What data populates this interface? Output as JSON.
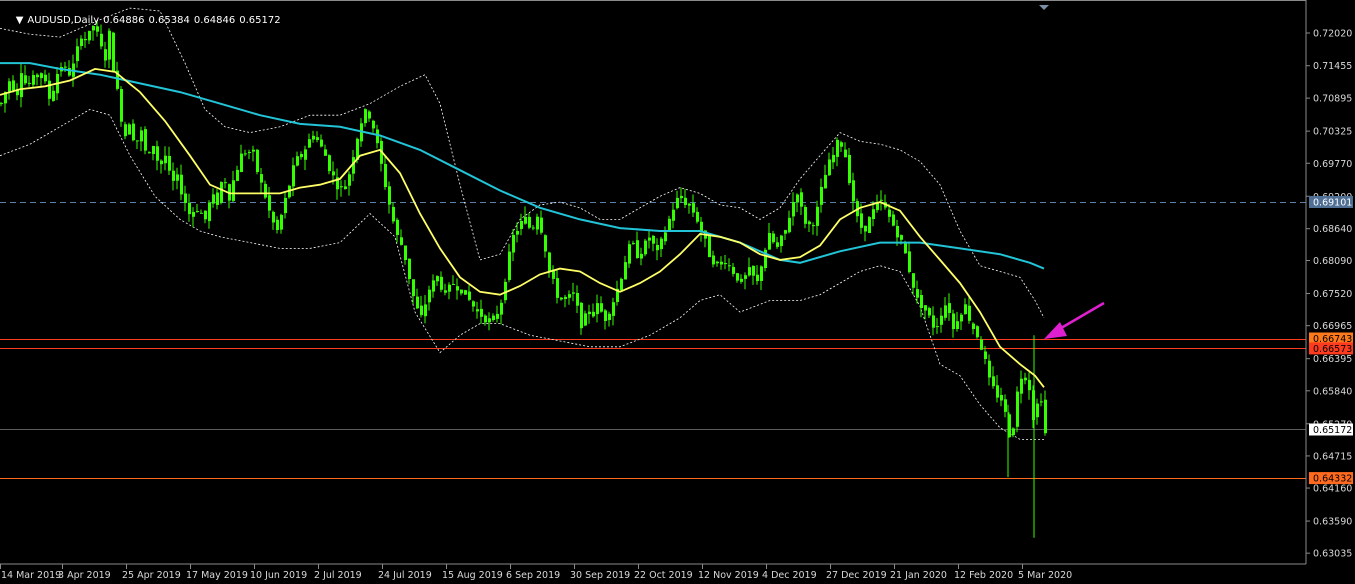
{
  "header": {
    "symbol": "AUDUSD,Daily",
    "open": "0.64886",
    "high": "0.65384",
    "low": "0.64846",
    "close": "0.65172"
  },
  "colors": {
    "background": "#000000",
    "candles": "#33ff00",
    "ma_fast": "#ffff66",
    "ma_slow": "#22c4d8",
    "bands": "#ffffff",
    "resistance": "#ff3b1f",
    "support": "#ff6a1f",
    "dashed_level": "#5a7fa8",
    "arrow": "#e020d0",
    "axis": "#d8d8d8"
  },
  "chart_data": {
    "type": "line",
    "symbol": "AUDUSD",
    "timeframe": "Daily",
    "ylim": [
      0.63,
      0.726
    ],
    "yticks": [
      "0.72020",
      "0.71455",
      "0.70895",
      "0.70325",
      "0.69770",
      "0.69200",
      "0.68640",
      "0.68090",
      "0.67520",
      "0.66965",
      "0.66395",
      "0.65840",
      "0.65270",
      "0.64715",
      "0.64160",
      "0.63590",
      "0.63035"
    ],
    "x_labels": [
      "14 Mar 2019",
      "3 Apr 2019",
      "25 Apr 2019",
      "17 May 2019",
      "10 Jun 2019",
      "2 Jul 2019",
      "24 Jul 2019",
      "15 Aug 2019",
      "6 Sep 2019",
      "30 Sep 2019",
      "22 Oct 2019",
      "12 Nov 2019",
      "4 Dec 2019",
      "27 Dec 2019",
      "21 Jan 2020",
      "12 Feb 2020",
      "5 Mar 2020"
    ],
    "price_levels": [
      {
        "value": 0.69101,
        "label": "0.69101",
        "style": "dashed"
      },
      {
        "value": 0.66743,
        "label": "0.66743",
        "style": "solid"
      },
      {
        "value": 0.66573,
        "label": "0.66573",
        "style": "solid"
      },
      {
        "value": 0.65172,
        "label": "0.65172",
        "style": "current"
      },
      {
        "value": 0.64332,
        "label": "0.64332",
        "style": "solid"
      }
    ],
    "price_path": [
      [
        0,
        0.708
      ],
      [
        8,
        0.712
      ],
      [
        16,
        0.71
      ],
      [
        20,
        0.714
      ],
      [
        25,
        0.711
      ],
      [
        34,
        0.7125
      ],
      [
        40,
        0.7135
      ],
      [
        48,
        0.709
      ],
      [
        54,
        0.7115
      ],
      [
        58,
        0.715
      ],
      [
        63,
        0.714
      ],
      [
        70,
        0.713
      ],
      [
        74,
        0.716
      ],
      [
        80,
        0.72
      ],
      [
        86,
        0.719
      ],
      [
        92,
        0.7215
      ],
      [
        98,
        0.719
      ],
      [
        103,
        0.715
      ],
      [
        108,
        0.72
      ],
      [
        113,
        0.713
      ],
      [
        118,
        0.708
      ],
      [
        123,
        0.702
      ],
      [
        128,
        0.705
      ],
      [
        134,
        0.701
      ],
      [
        140,
        0.703
      ],
      [
        146,
        0.698
      ],
      [
        152,
        0.701
      ],
      [
        158,
        0.697
      ],
      [
        164,
        0.699
      ],
      [
        170,
        0.694
      ],
      [
        176,
        0.695
      ],
      [
        182,
        0.692
      ],
      [
        188,
        0.689
      ],
      [
        196,
        0.69
      ],
      [
        204,
        0.688
      ],
      [
        210,
        0.692
      ],
      [
        216,
        0.691
      ],
      [
        222,
        0.696
      ],
      [
        228,
        0.692
      ],
      [
        234,
        0.696
      ],
      [
        240,
        0.699
      ],
      [
        246,
        0.7
      ],
      [
        252,
        0.699
      ],
      [
        258,
        0.695
      ],
      [
        264,
        0.692
      ],
      [
        270,
        0.688
      ],
      [
        276,
        0.686
      ],
      [
        282,
        0.69
      ],
      [
        288,
        0.694
      ],
      [
        294,
        0.698
      ],
      [
        300,
        0.699
      ],
      [
        306,
        0.701
      ],
      [
        312,
        0.703
      ],
      [
        318,
        0.701
      ],
      [
        324,
        0.699
      ],
      [
        330,
        0.696
      ],
      [
        336,
        0.694
      ],
      [
        342,
        0.693
      ],
      [
        348,
        0.696
      ],
      [
        354,
        0.701
      ],
      [
        360,
        0.705
      ],
      [
        366,
        0.707
      ],
      [
        372,
        0.704
      ],
      [
        378,
        0.699
      ],
      [
        384,
        0.694
      ],
      [
        390,
        0.689
      ],
      [
        396,
        0.685
      ],
      [
        402,
        0.683
      ],
      [
        408,
        0.678
      ],
      [
        414,
        0.673
      ],
      [
        420,
        0.671
      ],
      [
        428,
        0.676
      ],
      [
        436,
        0.678
      ],
      [
        444,
        0.675
      ],
      [
        452,
        0.677
      ],
      [
        460,
        0.676
      ],
      [
        468,
        0.674
      ],
      [
        476,
        0.672
      ],
      [
        484,
        0.671
      ],
      [
        492,
        0.67
      ],
      [
        500,
        0.674
      ],
      [
        506,
        0.68
      ],
      [
        512,
        0.685
      ],
      [
        518,
        0.687
      ],
      [
        524,
        0.688
      ],
      [
        530,
        0.686
      ],
      [
        536,
        0.689
      ],
      [
        542,
        0.685
      ],
      [
        548,
        0.679
      ],
      [
        556,
        0.675
      ],
      [
        564,
        0.674
      ],
      [
        572,
        0.675
      ],
      [
        580,
        0.67
      ],
      [
        588,
        0.672
      ],
      [
        596,
        0.673
      ],
      [
        604,
        0.671
      ],
      [
        612,
        0.674
      ],
      [
        618,
        0.677
      ],
      [
        624,
        0.681
      ],
      [
        630,
        0.684
      ],
      [
        636,
        0.682
      ],
      [
        642,
        0.683
      ],
      [
        648,
        0.685
      ],
      [
        656,
        0.682
      ],
      [
        664,
        0.686
      ],
      [
        672,
        0.69
      ],
      [
        678,
        0.692
      ],
      [
        684,
        0.691
      ],
      [
        690,
        0.69
      ],
      [
        696,
        0.688
      ],
      [
        702,
        0.685
      ],
      [
        708,
        0.682
      ],
      [
        716,
        0.68
      ],
      [
        724,
        0.681
      ],
      [
        732,
        0.679
      ],
      [
        740,
        0.677
      ],
      [
        748,
        0.679
      ],
      [
        756,
        0.677
      ],
      [
        762,
        0.682
      ],
      [
        768,
        0.685
      ],
      [
        776,
        0.683
      ],
      [
        784,
        0.686
      ],
      [
        790,
        0.69
      ],
      [
        796,
        0.693
      ],
      [
        802,
        0.688
      ],
      [
        808,
        0.687
      ],
      [
        814,
        0.688
      ],
      [
        820,
        0.693
      ],
      [
        826,
        0.697
      ],
      [
        832,
        0.699
      ],
      [
        838,
        0.702
      ],
      [
        844,
        0.699
      ],
      [
        850,
        0.693
      ],
      [
        856,
        0.688
      ],
      [
        862,
        0.686
      ],
      [
        868,
        0.688
      ],
      [
        874,
        0.69
      ],
      [
        880,
        0.691
      ],
      [
        886,
        0.689
      ],
      [
        892,
        0.687
      ],
      [
        898,
        0.685
      ],
      [
        904,
        0.682
      ],
      [
        910,
        0.678
      ],
      [
        916,
        0.674
      ],
      [
        922,
        0.673
      ],
      [
        928,
        0.671
      ],
      [
        934,
        0.669
      ],
      [
        940,
        0.672
      ],
      [
        946,
        0.674
      ],
      [
        952,
        0.669
      ],
      [
        958,
        0.672
      ],
      [
        964,
        0.673
      ],
      [
        970,
        0.67
      ],
      [
        976,
        0.668
      ],
      [
        982,
        0.665
      ],
      [
        988,
        0.66
      ],
      [
        994,
        0.658
      ],
      [
        1000,
        0.657
      ],
      [
        1006,
        0.653
      ],
      [
        1010,
        0.649
      ],
      [
        1014,
        0.656
      ],
      [
        1018,
        0.66
      ],
      [
        1022,
        0.662
      ],
      [
        1026,
        0.66
      ],
      [
        1030,
        0.658
      ],
      [
        1034,
        0.65
      ],
      [
        1038,
        0.662
      ],
      [
        1041,
        0.655
      ],
      [
        1044,
        0.651
      ]
    ],
    "ma_fast": [
      [
        0,
        0.7095
      ],
      [
        20,
        0.7105
      ],
      [
        45,
        0.711
      ],
      [
        70,
        0.712
      ],
      [
        95,
        0.714
      ],
      [
        115,
        0.7135
      ],
      [
        140,
        0.71
      ],
      [
        165,
        0.705
      ],
      [
        190,
        0.699
      ],
      [
        210,
        0.694
      ],
      [
        230,
        0.6925
      ],
      [
        255,
        0.6925
      ],
      [
        280,
        0.6925
      ],
      [
        300,
        0.6935
      ],
      [
        320,
        0.694
      ],
      [
        340,
        0.695
      ],
      [
        360,
        0.699
      ],
      [
        380,
        0.7
      ],
      [
        400,
        0.696
      ],
      [
        420,
        0.689
      ],
      [
        440,
        0.683
      ],
      [
        460,
        0.678
      ],
      [
        480,
        0.6755
      ],
      [
        500,
        0.675
      ],
      [
        520,
        0.6765
      ],
      [
        540,
        0.6785
      ],
      [
        560,
        0.6795
      ],
      [
        580,
        0.679
      ],
      [
        600,
        0.677
      ],
      [
        620,
        0.6755
      ],
      [
        640,
        0.677
      ],
      [
        660,
        0.679
      ],
      [
        680,
        0.682
      ],
      [
        700,
        0.6855
      ],
      [
        720,
        0.685
      ],
      [
        740,
        0.684
      ],
      [
        760,
        0.682
      ],
      [
        780,
        0.681
      ],
      [
        800,
        0.6815
      ],
      [
        820,
        0.6835
      ],
      [
        840,
        0.688
      ],
      [
        860,
        0.69
      ],
      [
        880,
        0.691
      ],
      [
        900,
        0.6895
      ],
      [
        920,
        0.685
      ],
      [
        940,
        0.681
      ],
      [
        960,
        0.677
      ],
      [
        980,
        0.672
      ],
      [
        1000,
        0.666
      ],
      [
        1020,
        0.663
      ],
      [
        1035,
        0.661
      ],
      [
        1044,
        0.659
      ]
    ],
    "ma_slow": [
      [
        0,
        0.715
      ],
      [
        30,
        0.715
      ],
      [
        60,
        0.714
      ],
      [
        100,
        0.713
      ],
      [
        140,
        0.7115
      ],
      [
        180,
        0.71
      ],
      [
        220,
        0.708
      ],
      [
        260,
        0.706
      ],
      [
        300,
        0.7045
      ],
      [
        340,
        0.704
      ],
      [
        380,
        0.7025
      ],
      [
        420,
        0.7
      ],
      [
        460,
        0.6965
      ],
      [
        500,
        0.693
      ],
      [
        540,
        0.69
      ],
      [
        580,
        0.688
      ],
      [
        620,
        0.6865
      ],
      [
        660,
        0.686
      ],
      [
        700,
        0.686
      ],
      [
        740,
        0.684
      ],
      [
        780,
        0.681
      ],
      [
        800,
        0.6805
      ],
      [
        840,
        0.6825
      ],
      [
        880,
        0.684
      ],
      [
        920,
        0.684
      ],
      [
        960,
        0.683
      ],
      [
        1000,
        0.682
      ],
      [
        1030,
        0.6805
      ],
      [
        1044,
        0.6795
      ]
    ],
    "band_upper": [
      [
        0,
        0.721
      ],
      [
        30,
        0.72
      ],
      [
        60,
        0.7195
      ],
      [
        100,
        0.7225
      ],
      [
        130,
        0.7245
      ],
      [
        160,
        0.724
      ],
      [
        185,
        0.715
      ],
      [
        205,
        0.707
      ],
      [
        225,
        0.704
      ],
      [
        250,
        0.703
      ],
      [
        280,
        0.704
      ],
      [
        310,
        0.706
      ],
      [
        340,
        0.706
      ],
      [
        370,
        0.708
      ],
      [
        400,
        0.711
      ],
      [
        425,
        0.713
      ],
      [
        440,
        0.708
      ],
      [
        460,
        0.694
      ],
      [
        480,
        0.681
      ],
      [
        500,
        0.682
      ],
      [
        520,
        0.688
      ],
      [
        540,
        0.6905
      ],
      [
        560,
        0.691
      ],
      [
        580,
        0.69
      ],
      [
        600,
        0.688
      ],
      [
        620,
        0.688
      ],
      [
        640,
        0.69
      ],
      [
        660,
        0.692
      ],
      [
        680,
        0.6935
      ],
      [
        700,
        0.6925
      ],
      [
        720,
        0.6905
      ],
      [
        740,
        0.69
      ],
      [
        760,
        0.688
      ],
      [
        780,
        0.69
      ],
      [
        800,
        0.695
      ],
      [
        820,
        0.699
      ],
      [
        840,
        0.703
      ],
      [
        860,
        0.7015
      ],
      [
        880,
        0.701
      ],
      [
        900,
        0.7
      ],
      [
        920,
        0.698
      ],
      [
        940,
        0.694
      ],
      [
        960,
        0.686
      ],
      [
        980,
        0.68
      ],
      [
        1000,
        0.679
      ],
      [
        1020,
        0.678
      ],
      [
        1035,
        0.674
      ],
      [
        1044,
        0.671
      ]
    ],
    "band_lower": [
      [
        0,
        0.699
      ],
      [
        30,
        0.701
      ],
      [
        60,
        0.704
      ],
      [
        90,
        0.707
      ],
      [
        110,
        0.706
      ],
      [
        130,
        0.699
      ],
      [
        155,
        0.692
      ],
      [
        180,
        0.688
      ],
      [
        200,
        0.686
      ],
      [
        220,
        0.685
      ],
      [
        250,
        0.684
      ],
      [
        280,
        0.683
      ],
      [
        310,
        0.683
      ],
      [
        340,
        0.684
      ],
      [
        370,
        0.689
      ],
      [
        395,
        0.685
      ],
      [
        415,
        0.672
      ],
      [
        440,
        0.665
      ],
      [
        460,
        0.668
      ],
      [
        480,
        0.67
      ],
      [
        500,
        0.67
      ],
      [
        530,
        0.668
      ],
      [
        560,
        0.667
      ],
      [
        590,
        0.666
      ],
      [
        620,
        0.666
      ],
      [
        650,
        0.668
      ],
      [
        680,
        0.671
      ],
      [
        700,
        0.674
      ],
      [
        720,
        0.675
      ],
      [
        740,
        0.672
      ],
      [
        770,
        0.674
      ],
      [
        800,
        0.674
      ],
      [
        820,
        0.675
      ],
      [
        840,
        0.677
      ],
      [
        860,
        0.679
      ],
      [
        880,
        0.68
      ],
      [
        900,
        0.679
      ],
      [
        920,
        0.673
      ],
      [
        940,
        0.663
      ],
      [
        960,
        0.661
      ],
      [
        980,
        0.656
      ],
      [
        1000,
        0.652
      ],
      [
        1020,
        0.65
      ],
      [
        1044,
        0.65
      ]
    ],
    "spike_low": [
      1034,
      0.633
    ]
  }
}
